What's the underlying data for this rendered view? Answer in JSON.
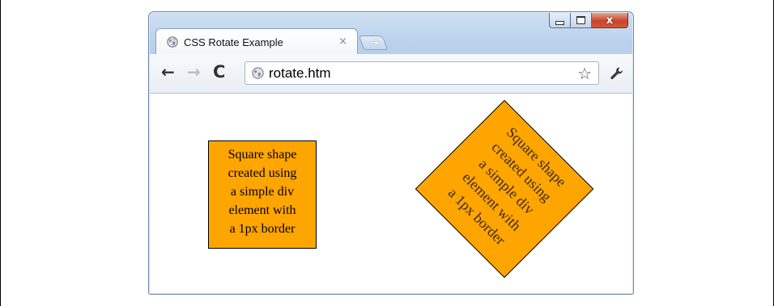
{
  "tab": {
    "title": "CSS Rotate Example",
    "close_glyph": "×",
    "favicon": "globe-icon"
  },
  "new_tab": {
    "glyph": "+",
    "icon": "new-tab-icon"
  },
  "window_controls": {
    "minimize_icon": "minimize-icon",
    "maximize_icon": "maximize-icon",
    "close_glyph": "x"
  },
  "toolbar": {
    "back_glyph": "←",
    "forward_glyph": "→",
    "reload_glyph": "C",
    "url": "rotate.htm",
    "star_glyph": "☆",
    "wrench_icon": "wrench-icon"
  },
  "content": {
    "square_lines": [
      "Square shape",
      "created using",
      "a simple div",
      "element with",
      "a 1px border"
    ],
    "rotated_square_lines": [
      "Square shape",
      "created using",
      "a simple div",
      "element with",
      "a 1px border"
    ],
    "rotation_degrees": 45,
    "square_color": "#ffa500",
    "border_color": "#000000"
  }
}
